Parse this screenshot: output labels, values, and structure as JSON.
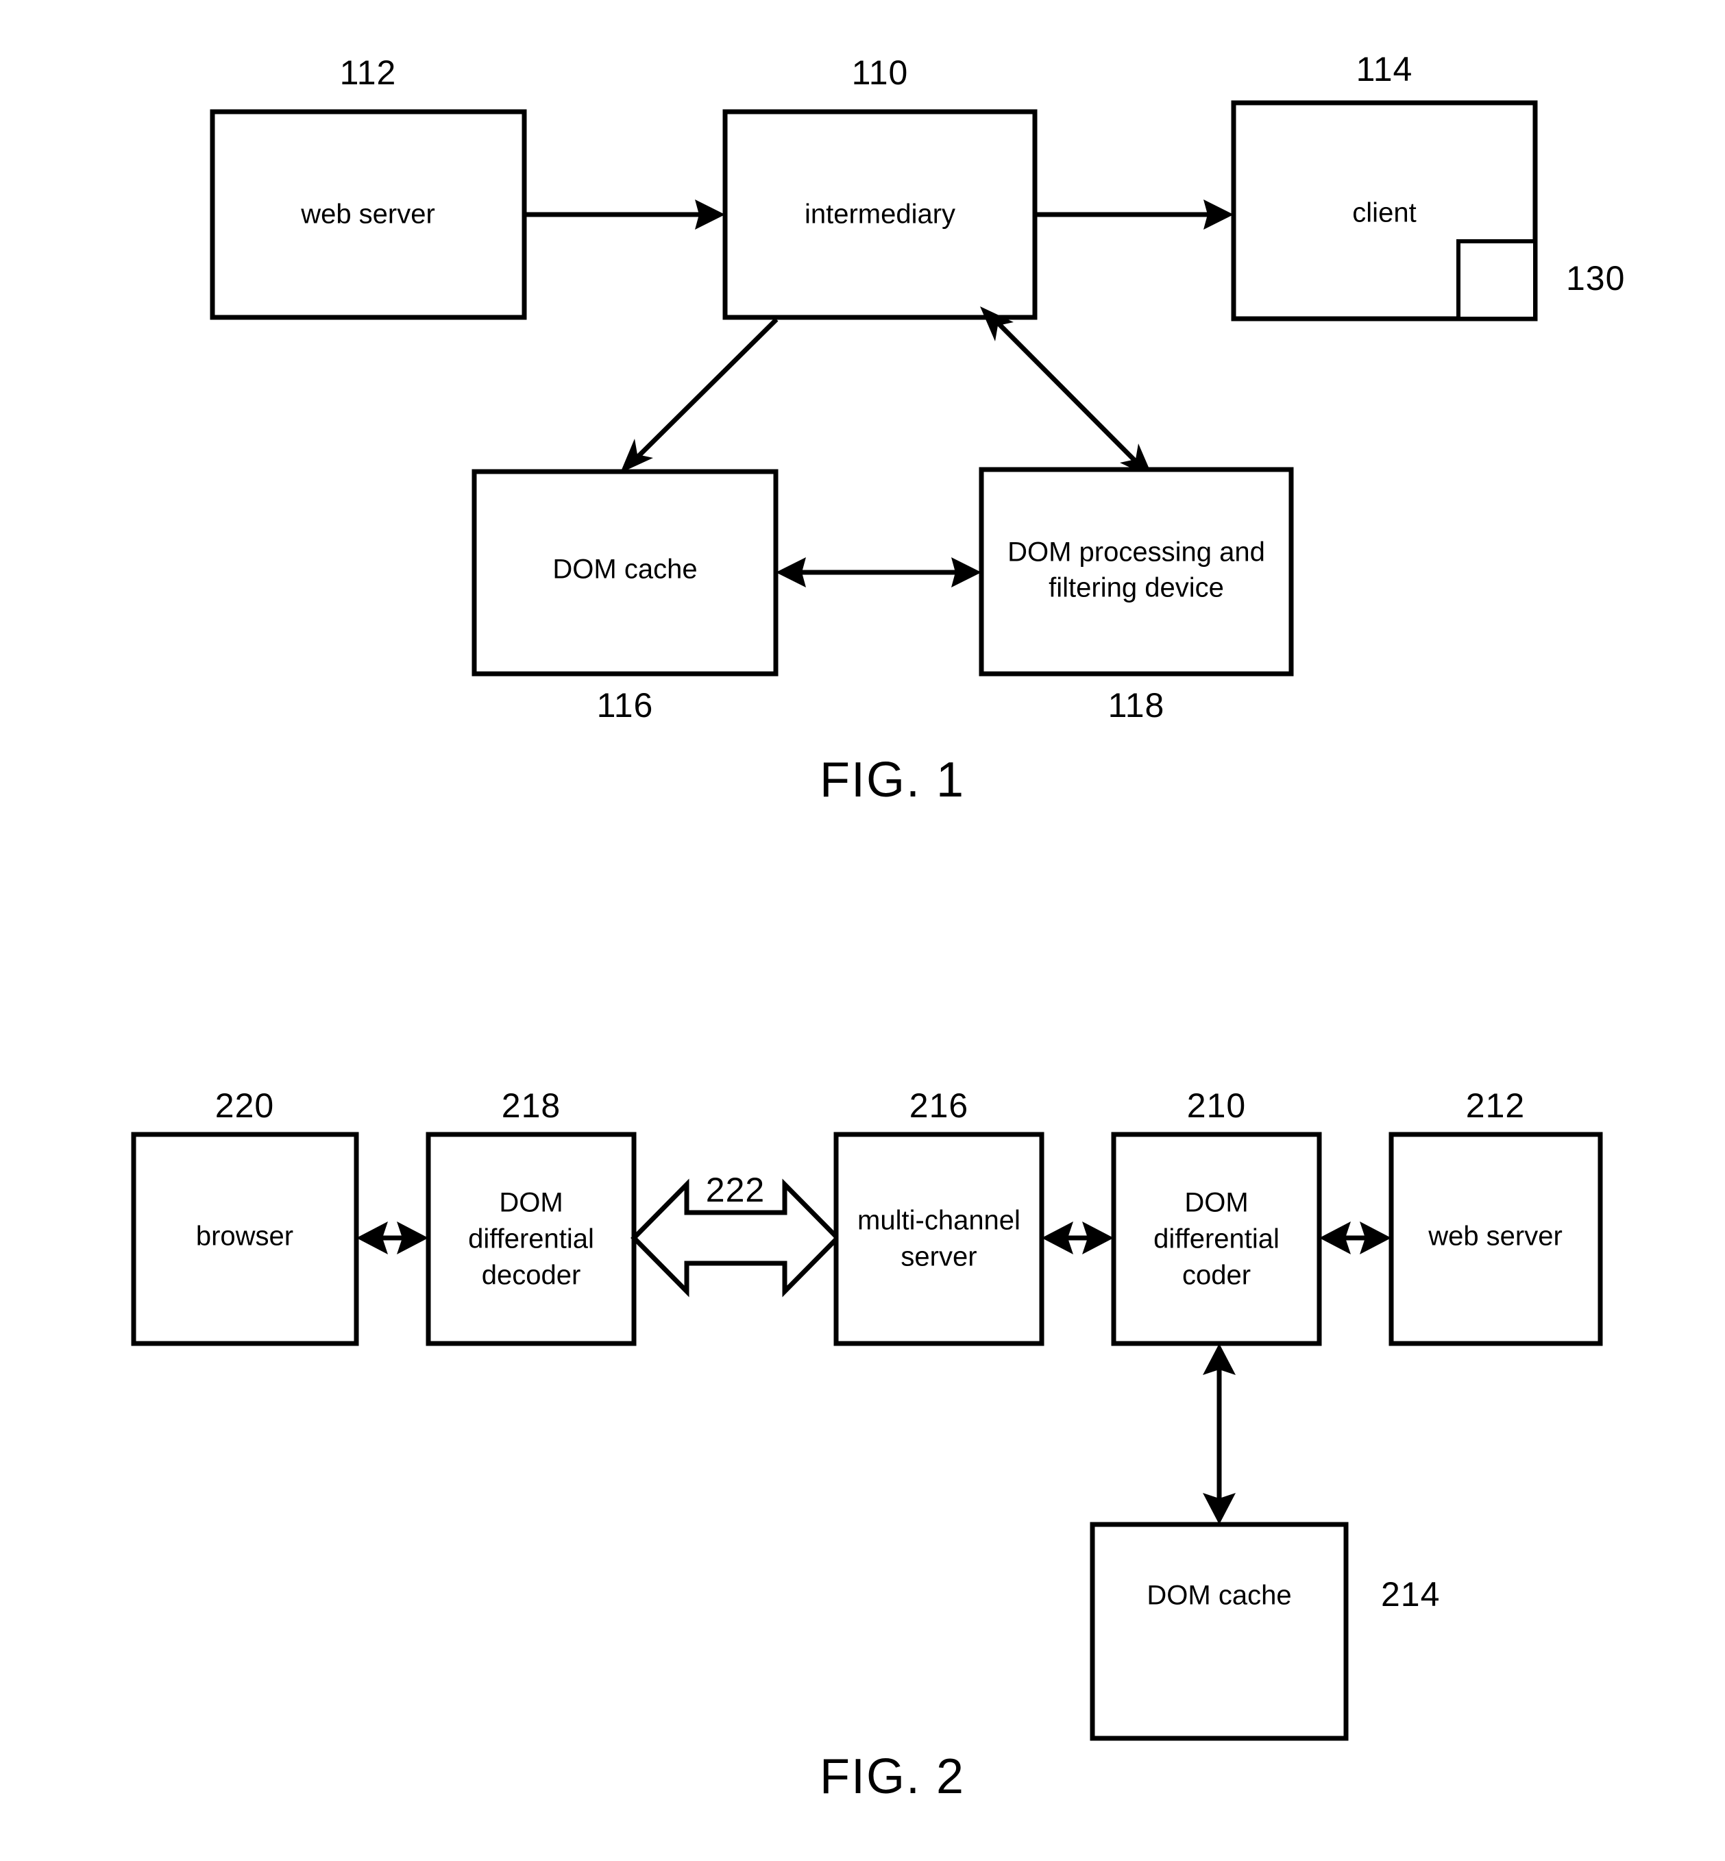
{
  "document": {
    "type": "patent-drawing-sheet",
    "background_color": "#ffffff",
    "ink_color": "#000000"
  },
  "figures": [
    {
      "id": "fig-1",
      "caption": "FIG. 1",
      "nodes": [
        {
          "key": "web_server",
          "label": "web server",
          "ref": "112",
          "ref_position": "above"
        },
        {
          "key": "intermediary",
          "label": "intermediary",
          "ref": "110",
          "ref_position": "above"
        },
        {
          "key": "client",
          "label": "client",
          "ref": "114",
          "ref_position": "above"
        },
        {
          "key": "inner_window",
          "label": "",
          "ref": "130",
          "ref_position": "right"
        },
        {
          "key": "dom_cache",
          "label": "DOM cache",
          "ref": "116",
          "ref_position": "below"
        },
        {
          "key": "dom_proc",
          "label_line1": "DOM processing and",
          "label_line2": "filtering device",
          "ref": "118",
          "ref_position": "below"
        }
      ],
      "connections": [
        {
          "from": "web_server",
          "to": "intermediary",
          "arrow": "single"
        },
        {
          "from": "intermediary",
          "to": "client",
          "arrow": "single"
        },
        {
          "from": "intermediary",
          "to": "dom_cache",
          "arrow": "single"
        },
        {
          "from": "intermediary",
          "to": "dom_proc",
          "arrow": "double"
        },
        {
          "from": "dom_cache",
          "to": "dom_proc",
          "arrow": "double"
        }
      ]
    },
    {
      "id": "fig-2",
      "caption": "FIG. 2",
      "nodes": [
        {
          "key": "browser",
          "label": "browser",
          "ref": "220",
          "ref_position": "above"
        },
        {
          "key": "decoder",
          "label_line1": "DOM",
          "label_line2": "differential",
          "label_line3": "decoder",
          "ref": "218",
          "ref_position": "above"
        },
        {
          "key": "mcserver",
          "label_line1": "multi-channel",
          "label_line2": "server",
          "ref": "216",
          "ref_position": "above"
        },
        {
          "key": "coder",
          "label_line1": "DOM",
          "label_line2": "differential",
          "label_line3": "coder",
          "ref": "210",
          "ref_position": "above"
        },
        {
          "key": "webserver",
          "label": "web server",
          "ref": "212",
          "ref_position": "above"
        },
        {
          "key": "domcache",
          "label": "DOM cache",
          "ref": "214",
          "ref_position": "right"
        }
      ],
      "connections": [
        {
          "from": "browser",
          "to": "decoder",
          "arrow": "double",
          "style": "line"
        },
        {
          "from": "decoder",
          "to": "mcserver",
          "arrow": "double",
          "style": "block",
          "ref": "222"
        },
        {
          "from": "mcserver",
          "to": "coder",
          "arrow": "double",
          "style": "line"
        },
        {
          "from": "coder",
          "to": "webserver",
          "arrow": "double",
          "style": "line"
        },
        {
          "from": "domcache",
          "to": "coder",
          "arrow": "double",
          "style": "line"
        }
      ]
    }
  ]
}
